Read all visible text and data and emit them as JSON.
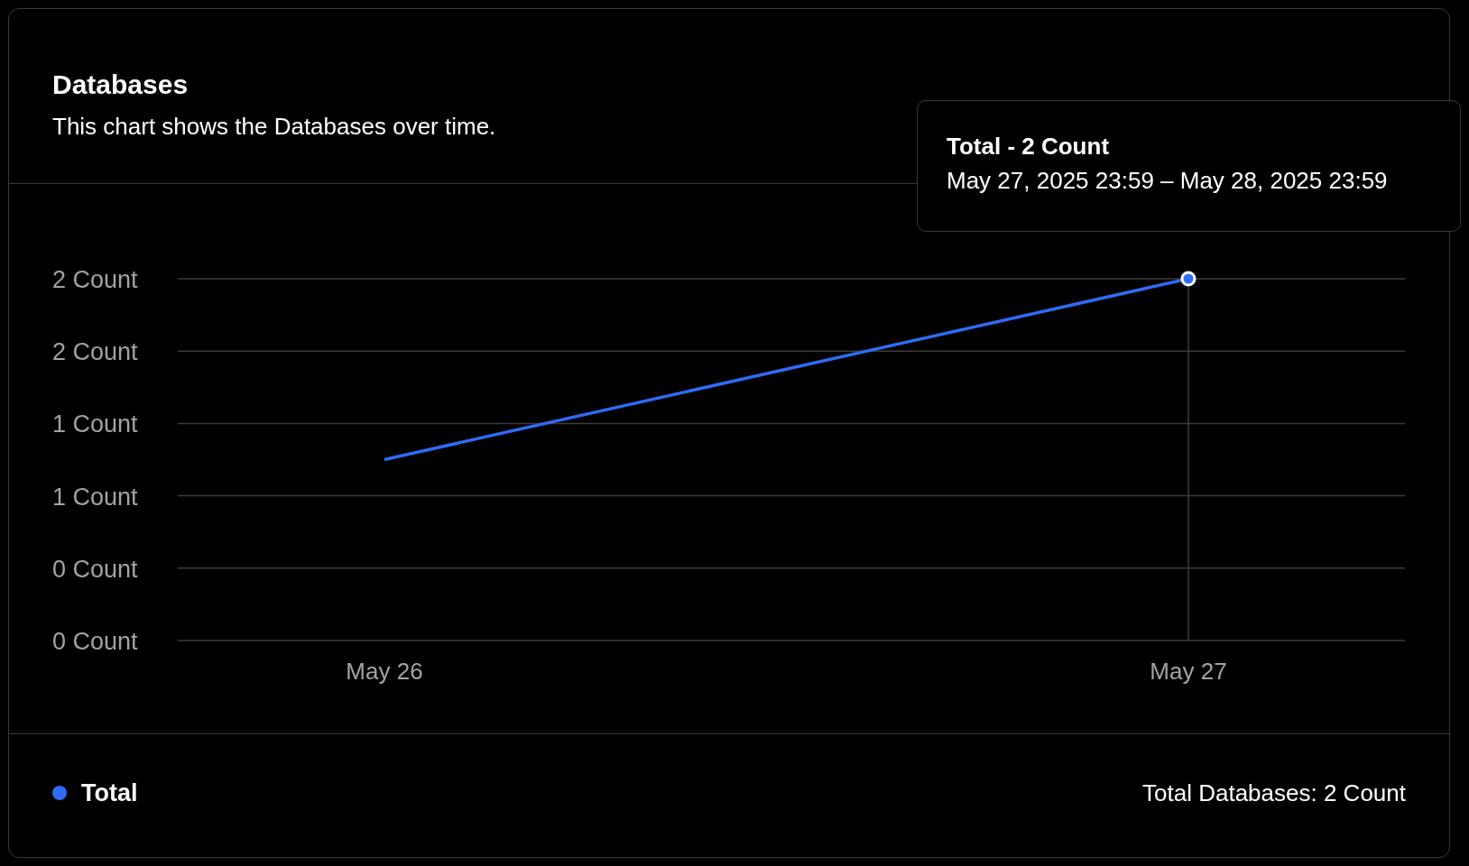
{
  "card": {
    "title": "Databases",
    "description": "This chart shows the Databases over time."
  },
  "chart": {
    "chart_data": {
      "type": "line",
      "categories": [
        "May 26",
        "May 27"
      ],
      "series": [
        {
          "name": "Total",
          "color": "#2f6bf5",
          "values": [
            1,
            2
          ]
        }
      ],
      "ylim": [
        0,
        2
      ],
      "grid": true,
      "yticks": [
        {
          "value": 2,
          "label": "2 Count"
        },
        {
          "value": 1.6,
          "label": "2 Count"
        },
        {
          "value": 1.2,
          "label": "1 Count"
        },
        {
          "value": 0.8,
          "label": "1 Count"
        },
        {
          "value": 0.4,
          "label": "0 Count"
        },
        {
          "value": 0,
          "label": "0 Count"
        }
      ]
    },
    "tooltip": {
      "title": "Total - 2 Count",
      "range": "May 27, 2025 23:59 – May 28, 2025 23:59"
    }
  },
  "footer": {
    "summary": "Total Databases: 2 Count"
  }
}
